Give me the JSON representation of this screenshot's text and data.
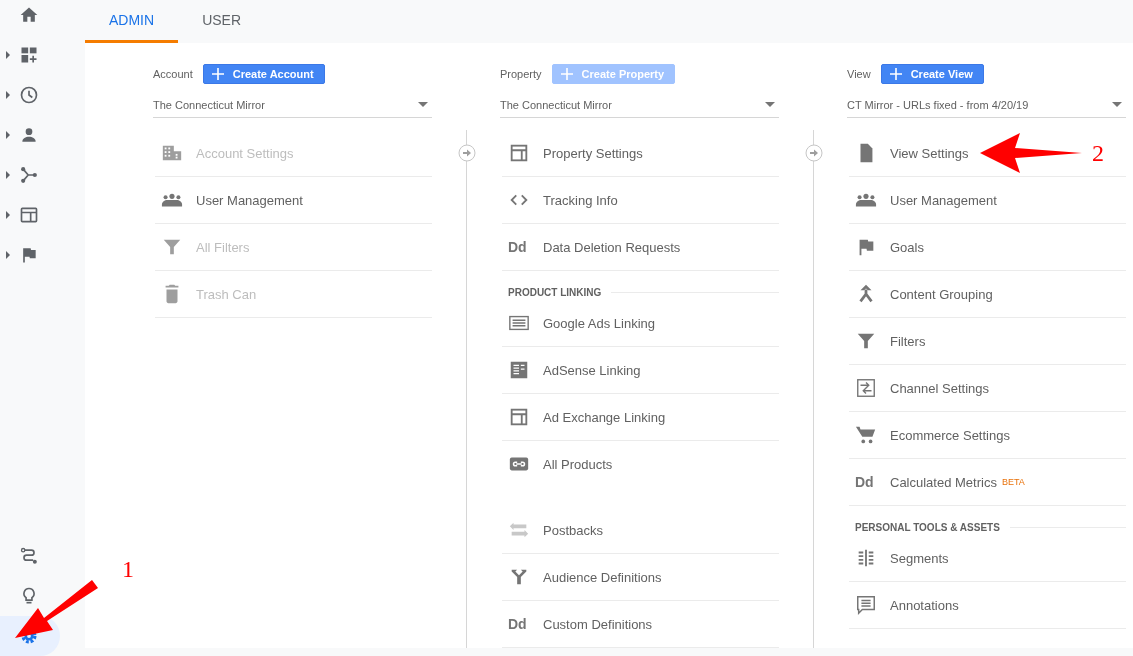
{
  "sidebar": {
    "items": [
      {
        "kind": "home",
        "expandable": false,
        "selected": false
      },
      {
        "kind": "dashboard",
        "expandable": true,
        "selected": false
      },
      {
        "kind": "clock",
        "expandable": true,
        "selected": false
      },
      {
        "kind": "person",
        "expandable": true,
        "selected": false
      },
      {
        "kind": "fork",
        "expandable": true,
        "selected": false
      },
      {
        "kind": "window",
        "expandable": true,
        "selected": false
      },
      {
        "kind": "flag",
        "expandable": true,
        "selected": false
      }
    ],
    "bottom_items": [
      {
        "kind": "route",
        "expandable": false,
        "selected": false
      },
      {
        "kind": "bulb",
        "expandable": false,
        "selected": false
      },
      {
        "kind": "gear",
        "expandable": false,
        "selected": true
      }
    ]
  },
  "tabs": [
    {
      "label": "ADMIN",
      "selected": true
    },
    {
      "label": "USER",
      "selected": false
    }
  ],
  "columns": [
    {
      "label": "Account",
      "connector": false,
      "create_button": {
        "label": "Create Account",
        "disabled": false
      },
      "selector": {
        "value": "The Connecticut Mirror"
      },
      "items": [
        {
          "kind": "building",
          "label": "Account Settings",
          "disabled": true
        },
        {
          "kind": "people",
          "label": "User Management",
          "disabled": false
        },
        {
          "kind": "filter",
          "label": "All Filters",
          "disabled": true
        },
        {
          "kind": "trash",
          "label": "Trash Can",
          "disabled": true
        }
      ]
    },
    {
      "label": "Property",
      "connector": true,
      "create_button": {
        "label": "Create Property",
        "disabled": true
      },
      "selector": {
        "value": "The Connecticut Mirror"
      },
      "items": [
        {
          "kind": "layout",
          "label": "Property Settings",
          "disabled": false
        },
        {
          "kind": "code",
          "label": "Tracking Info",
          "disabled": false
        },
        {
          "kind": "letters",
          "icon_text": "Dd",
          "label": "Data Deletion Requests",
          "disabled": false
        },
        {
          "kind": "header",
          "label": "PRODUCT LINKING"
        },
        {
          "kind": "ads",
          "label": "Google Ads Linking",
          "disabled": false
        },
        {
          "kind": "adsense",
          "label": "AdSense Linking",
          "disabled": false
        },
        {
          "kind": "layout",
          "label": "Ad Exchange Linking",
          "disabled": false
        },
        {
          "kind": "link",
          "label": "All Products",
          "disabled": false,
          "gap_after": true
        },
        {
          "kind": "postback",
          "label": "Postbacks",
          "disabled": false
        },
        {
          "kind": "audience",
          "label": "Audience Definitions",
          "disabled": false
        },
        {
          "kind": "letters",
          "icon_text": "Dd",
          "label": "Custom Definitions",
          "disabled": false
        }
      ]
    },
    {
      "label": "View",
      "connector": true,
      "create_button": {
        "label": "Create View",
        "disabled": false
      },
      "selector": {
        "value": "CT Mirror - URLs fixed - from 4/20/19"
      },
      "items": [
        {
          "kind": "doc",
          "label": "View Settings",
          "disabled": false
        },
        {
          "kind": "people",
          "label": "User Management",
          "disabled": false
        },
        {
          "kind": "flag",
          "label": "Goals",
          "disabled": false
        },
        {
          "kind": "grouping",
          "label": "Content Grouping",
          "disabled": false
        },
        {
          "kind": "filter",
          "label": "Filters",
          "disabled": false
        },
        {
          "kind": "channel",
          "label": "Channel Settings",
          "disabled": false
        },
        {
          "kind": "cart",
          "label": "Ecommerce Settings",
          "disabled": false
        },
        {
          "kind": "letters",
          "icon_text": "Dd",
          "label": "Calculated Metrics",
          "badge": "BETA",
          "disabled": false
        },
        {
          "kind": "header",
          "label": "PERSONAL TOOLS & ASSETS"
        },
        {
          "kind": "segments",
          "label": "Segments",
          "disabled": false
        },
        {
          "kind": "annotation",
          "label": "Annotations",
          "disabled": false
        }
      ]
    }
  ],
  "annotations": [
    {
      "kind": "gear",
      "label": "1"
    },
    {
      "kind": "view_settings",
      "label": "2"
    }
  ]
}
